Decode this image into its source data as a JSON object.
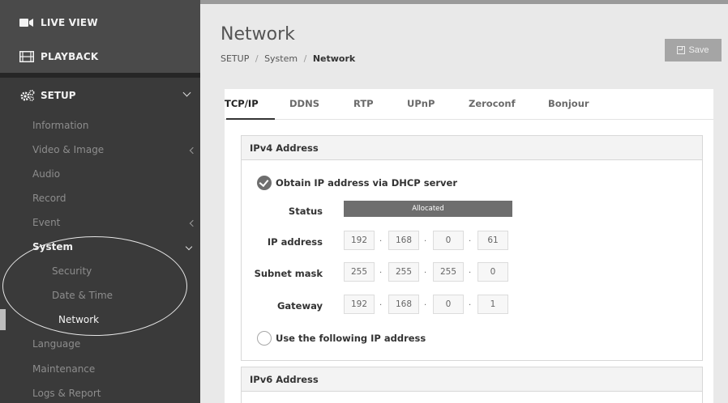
{
  "sidebar": {
    "live_view": "LIVE VIEW",
    "playback": "PLAYBACK",
    "setup": "SETUP",
    "items": [
      {
        "label": "Information"
      },
      {
        "label": "Video & Image"
      },
      {
        "label": "Audio"
      },
      {
        "label": "Record"
      },
      {
        "label": "Event"
      },
      {
        "label": "System"
      }
    ],
    "system_sub": [
      {
        "label": "Security"
      },
      {
        "label": "Date & Time"
      },
      {
        "label": "Network"
      }
    ],
    "items_after": [
      {
        "label": "Language"
      },
      {
        "label": "Maintenance"
      },
      {
        "label": "Logs & Report"
      }
    ]
  },
  "header": {
    "title": "Network",
    "breadcrumb": {
      "part1": "SETUP",
      "sep": "/",
      "part2": "System",
      "current": "Network"
    },
    "save_label": "Save"
  },
  "tabs": [
    {
      "label": "TCP/IP",
      "active": true
    },
    {
      "label": "DDNS"
    },
    {
      "label": "RTP"
    },
    {
      "label": "UPnP"
    },
    {
      "label": "Zeroconf"
    },
    {
      "label": "Bonjour"
    }
  ],
  "ipv4": {
    "heading": "IPv4 Address",
    "dhcp_label": "Obtain IP address via DHCP server",
    "status_label": "Status",
    "status_value": "Allocated",
    "ip_label": "IP address",
    "ip": [
      "192",
      "168",
      "0",
      "61"
    ],
    "subnet_label": "Subnet mask",
    "subnet": [
      "255",
      "255",
      "255",
      "0"
    ],
    "gateway_label": "Gateway",
    "gateway": [
      "192",
      "168",
      "0",
      "1"
    ],
    "static_label": "Use the following IP address",
    "dot": "."
  },
  "ipv6": {
    "heading": "IPv6 Address"
  },
  "colors": {
    "sidebar_bg": "#3a3a3a",
    "active_control": "#6e6e6e",
    "save_button": "#a5a5a5"
  }
}
